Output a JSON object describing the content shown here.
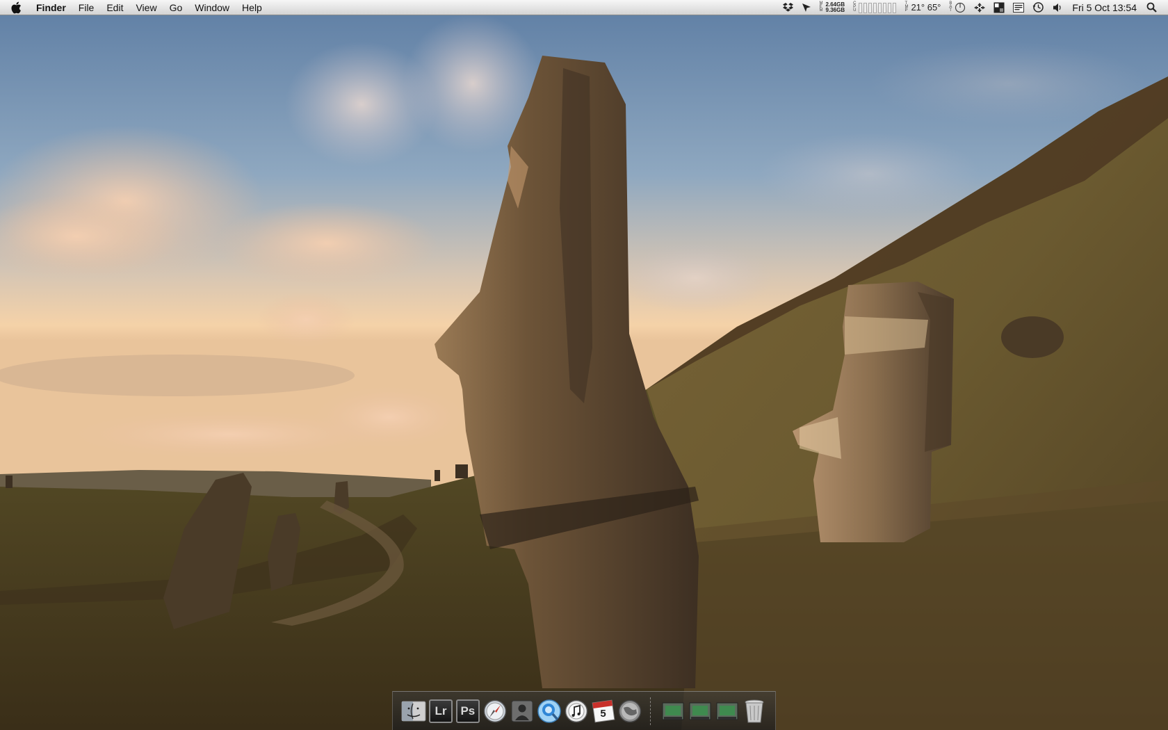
{
  "menubar": {
    "apple_icon": "apple-logo-icon",
    "app_name": "Finder",
    "menus": [
      "File",
      "Edit",
      "View",
      "Go",
      "Window",
      "Help"
    ],
    "status": {
      "dropbox_icon": "dropbox-icon",
      "location_icon": "cursor-arrow-icon",
      "mem_labels": [
        "M",
        "E",
        "M"
      ],
      "mem_used": "2.64GB",
      "mem_free": "9.36GB",
      "cpu_labels": [
        "C",
        "P",
        "U"
      ],
      "temp_labels": [
        "T",
        "M",
        "P"
      ],
      "temperature": "21° 65°",
      "battery_labels": [
        "B",
        "A",
        "T"
      ],
      "power_icon": "power-gauge-icon",
      "network_icon": "network-arrows-icon",
      "spaces_icon": "spaces-grid-icon",
      "keyboard_icon": "keyboard-viewer-icon",
      "time_machine_icon": "time-machine-icon",
      "volume_icon": "volume-icon",
      "clock": "Fri 5 Oct  13:54",
      "spotlight_icon": "spotlight-search-icon"
    }
  },
  "dock": {
    "apps": [
      {
        "name": "finder",
        "icon": "finder-icon"
      },
      {
        "name": "lightroom",
        "label": "Lr"
      },
      {
        "name": "photoshop",
        "label": "Ps"
      },
      {
        "name": "safari",
        "icon": "safari-compass-icon"
      },
      {
        "name": "contacts",
        "icon": "contacts-icon"
      },
      {
        "name": "mail-search",
        "icon": "quicktime-icon"
      },
      {
        "name": "itunes",
        "icon": "itunes-icon"
      },
      {
        "name": "ical",
        "label_month": "OCT",
        "label_day": "5"
      },
      {
        "name": "firefox",
        "icon": "globe-icon"
      }
    ],
    "stacks": [
      {
        "name": "stack-1",
        "icon": "folder-stack-icon"
      },
      {
        "name": "stack-2",
        "icon": "folder-stack-icon"
      },
      {
        "name": "stack-3",
        "icon": "folder-stack-icon"
      }
    ],
    "trash_icon": "trash-icon"
  },
  "colors": {
    "menubar_bg": "#e4e4e4",
    "sky_top": "#5f7fa3",
    "horizon": "#f3cfa6",
    "ground": "#5c4c2c"
  }
}
